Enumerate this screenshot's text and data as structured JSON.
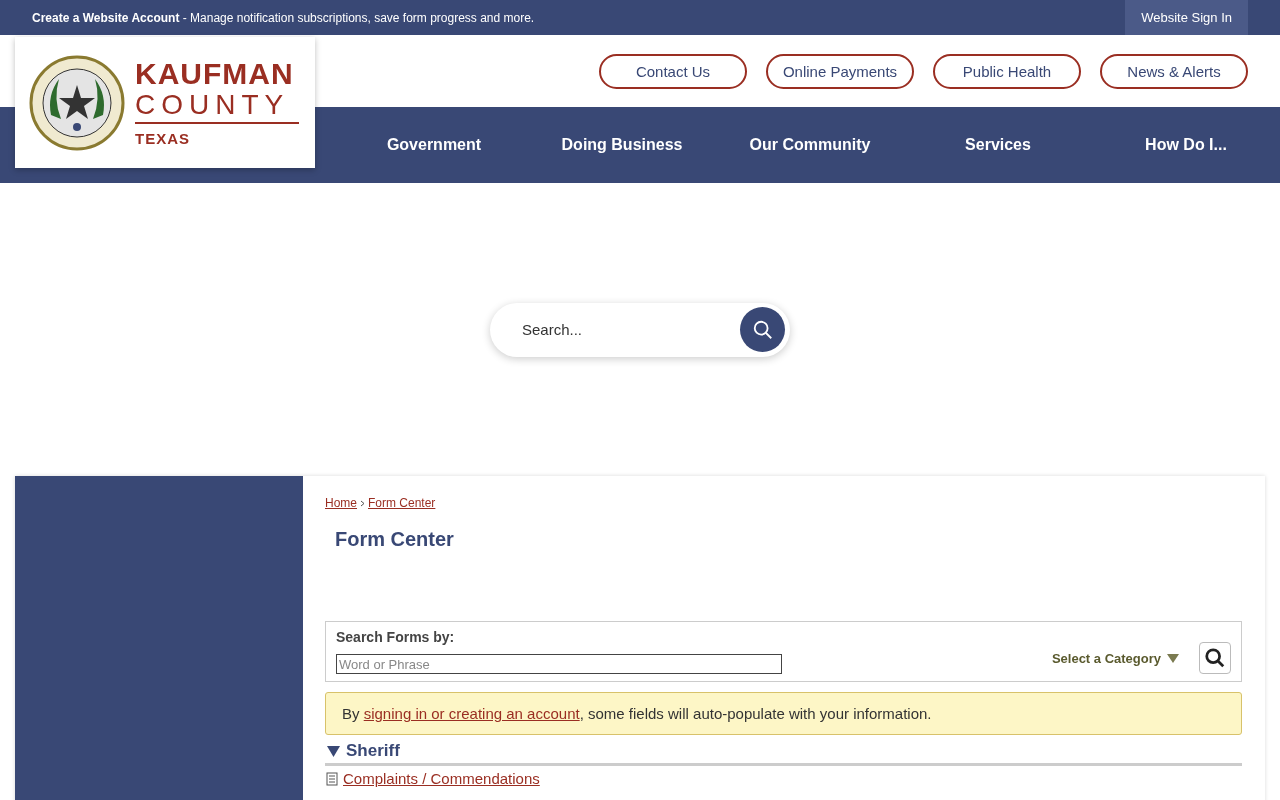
{
  "top_bar": {
    "account_link": "Create a Website Account",
    "account_text": " - Manage notification subscriptions, save form progress and more.",
    "sign_in": "Website Sign In"
  },
  "logo": {
    "name": "KAUFMAN",
    "sub": "COUNTY",
    "state": "TEXAS"
  },
  "quick_links": [
    "Contact Us",
    "Online Payments",
    "Public Health",
    "News & Alerts"
  ],
  "nav": [
    "Government",
    "Doing Business",
    "Our Community",
    "Services",
    "How Do I..."
  ],
  "search": {
    "placeholder": "Search..."
  },
  "breadcrumb": [
    "Home",
    "Form Center"
  ],
  "page_title": "Form Center",
  "form_search": {
    "label": "Search Forms by:",
    "placeholder": "Word or Phrase",
    "category": "Select a Category"
  },
  "notice": {
    "before": "By ",
    "link": "signing in or creating an account",
    "after": ", some fields will auto-populate with your information."
  },
  "categories": [
    {
      "name": "Sheriff",
      "expanded": true,
      "forms": [
        "Complaints / Commendations"
      ]
    }
  ]
}
